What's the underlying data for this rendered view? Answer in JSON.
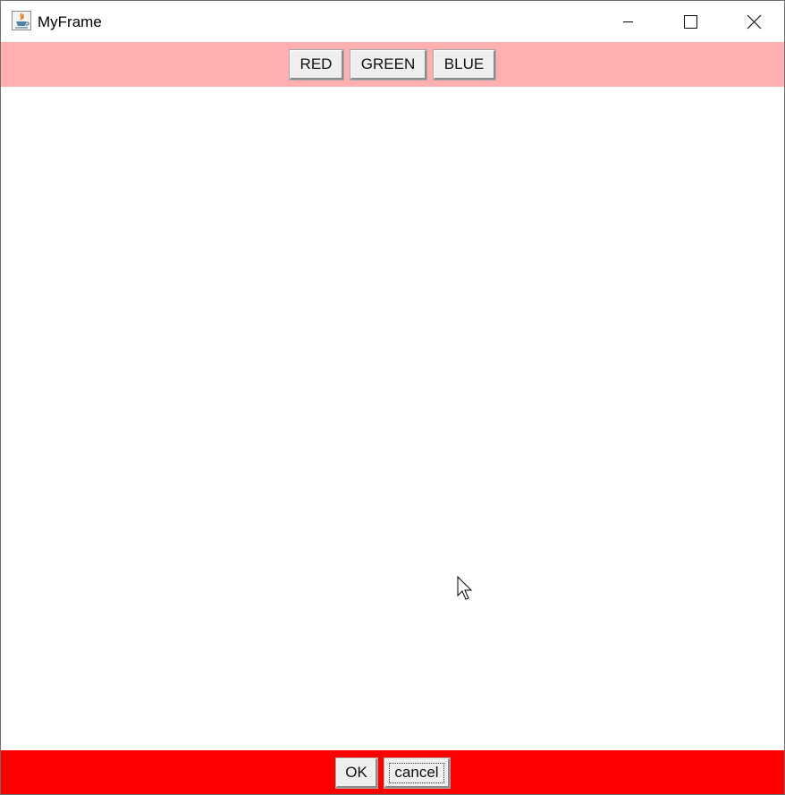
{
  "window": {
    "title": "MyFrame",
    "icon": "java-app-icon",
    "controls": [
      "minimize-icon",
      "maximize-icon",
      "close-icon"
    ]
  },
  "top_panel": {
    "background": "#ffafaf",
    "buttons": [
      "RED",
      "GREEN",
      "BLUE"
    ]
  },
  "bottom_panel": {
    "background": "#ff0000",
    "ok_label": "OK",
    "cancel_label": "cancel",
    "focused": "cancel"
  },
  "cursor": "mouse-pointer-icon"
}
